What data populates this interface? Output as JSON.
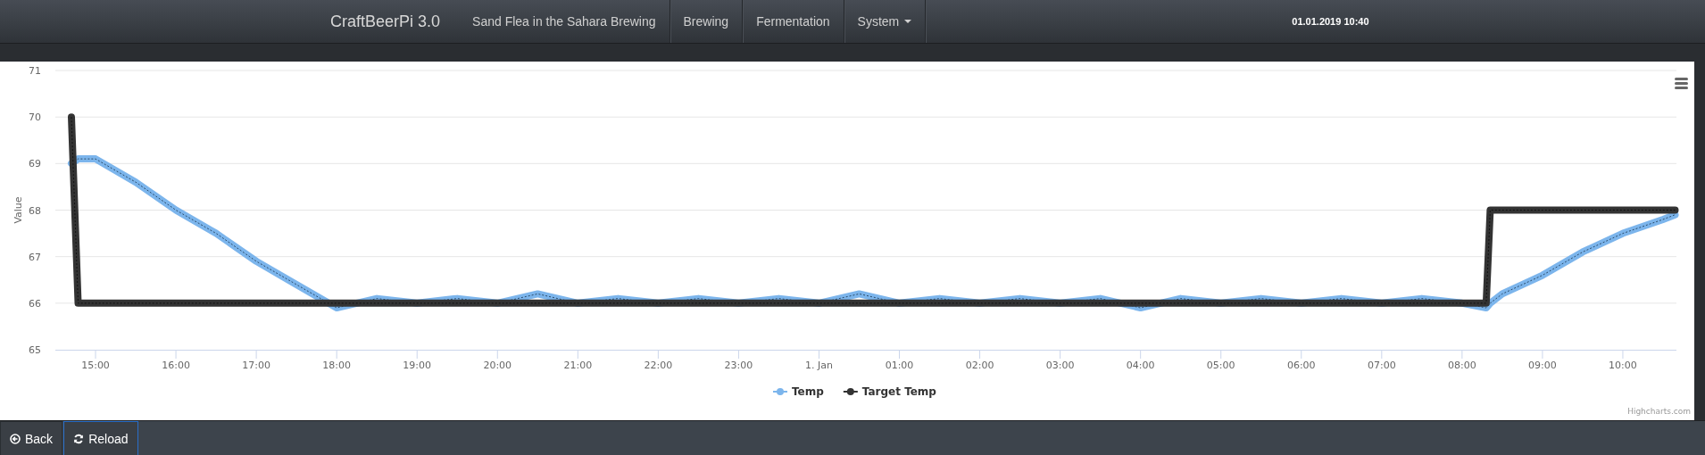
{
  "navbar": {
    "brand": "CraftBeerPi 3.0",
    "items": [
      {
        "label": "Sand Flea in the Sahara Brewing",
        "kind": "link"
      },
      {
        "label": "Brewing",
        "kind": "link"
      },
      {
        "label": "Fermentation",
        "kind": "link"
      },
      {
        "label": "System",
        "kind": "dropdown"
      }
    ],
    "datetime": "01.01.2019 10:40"
  },
  "chart": {
    "credit": "Highcharts.com",
    "chart_data": {
      "type": "line",
      "ylabel": "Value",
      "grid": true,
      "legend": true,
      "xlim": [
        "2018-12-31T14:30",
        "2019-01-01T10:40"
      ],
      "ylim": [
        65,
        71
      ],
      "yticks": [
        65,
        66,
        67,
        68,
        69,
        70,
        71
      ],
      "xticks": [
        {
          "value": "2018-12-31T15:00",
          "label": "15:00"
        },
        {
          "value": "2018-12-31T16:00",
          "label": "16:00"
        },
        {
          "value": "2018-12-31T17:00",
          "label": "17:00"
        },
        {
          "value": "2018-12-31T18:00",
          "label": "18:00"
        },
        {
          "value": "2018-12-31T19:00",
          "label": "19:00"
        },
        {
          "value": "2018-12-31T20:00",
          "label": "20:00"
        },
        {
          "value": "2018-12-31T21:00",
          "label": "21:00"
        },
        {
          "value": "2018-12-31T22:00",
          "label": "22:00"
        },
        {
          "value": "2018-12-31T23:00",
          "label": "23:00"
        },
        {
          "value": "2019-01-01T00:00",
          "label": "1. Jan"
        },
        {
          "value": "2019-01-01T01:00",
          "label": "01:00"
        },
        {
          "value": "2019-01-01T02:00",
          "label": "02:00"
        },
        {
          "value": "2019-01-01T03:00",
          "label": "03:00"
        },
        {
          "value": "2019-01-01T04:00",
          "label": "04:00"
        },
        {
          "value": "2019-01-01T05:00",
          "label": "05:00"
        },
        {
          "value": "2019-01-01T06:00",
          "label": "06:00"
        },
        {
          "value": "2019-01-01T07:00",
          "label": "07:00"
        },
        {
          "value": "2019-01-01T08:00",
          "label": "08:00"
        },
        {
          "value": "2019-01-01T09:00",
          "label": "09:00"
        },
        {
          "value": "2019-01-01T10:00",
          "label": "10:00"
        }
      ],
      "x": [
        "2018-12-31T14:42",
        "2018-12-31T14:47",
        "2018-12-31T15:00",
        "2018-12-31T15:30",
        "2018-12-31T16:00",
        "2018-12-31T16:30",
        "2018-12-31T17:00",
        "2018-12-31T17:30",
        "2018-12-31T18:00",
        "2018-12-31T18:30",
        "2018-12-31T19:00",
        "2018-12-31T19:30",
        "2018-12-31T20:00",
        "2018-12-31T20:30",
        "2018-12-31T21:00",
        "2018-12-31T21:30",
        "2018-12-31T22:00",
        "2018-12-31T22:30",
        "2018-12-31T23:00",
        "2018-12-31T23:30",
        "2019-01-01T00:00",
        "2019-01-01T00:30",
        "2019-01-01T01:00",
        "2019-01-01T01:30",
        "2019-01-01T02:00",
        "2019-01-01T02:30",
        "2019-01-01T03:00",
        "2019-01-01T03:30",
        "2019-01-01T04:00",
        "2019-01-01T04:30",
        "2019-01-01T05:00",
        "2019-01-01T05:30",
        "2019-01-01T06:00",
        "2019-01-01T06:30",
        "2019-01-01T07:00",
        "2019-01-01T07:30",
        "2019-01-01T08:00",
        "2019-01-01T08:18",
        "2019-01-01T08:21",
        "2019-01-01T08:30",
        "2019-01-01T09:00",
        "2019-01-01T09:30",
        "2019-01-01T10:00",
        "2019-01-01T10:30",
        "2019-01-01T10:39"
      ],
      "series": [
        {
          "name": "Temp",
          "color": "#7cb5ec",
          "values": [
            69,
            69.1,
            69.1,
            68.6,
            68.0,
            67.5,
            66.9,
            66.4,
            65.9,
            66.1,
            66.0,
            66.1,
            66.0,
            66.2,
            66.0,
            66.1,
            66.0,
            66.1,
            66.0,
            66.1,
            66.0,
            66.2,
            66.0,
            66.1,
            66.0,
            66.1,
            66.0,
            66.1,
            65.9,
            66.1,
            66.0,
            66.1,
            66.0,
            66.1,
            66.0,
            66.1,
            66.0,
            65.9,
            66.0,
            66.2,
            66.6,
            67.1,
            67.5,
            67.8,
            67.9
          ]
        },
        {
          "name": "Target Temp",
          "color": "#333333",
          "values": [
            70,
            66,
            66,
            66,
            66,
            66,
            66,
            66,
            66,
            66,
            66,
            66,
            66,
            66,
            66,
            66,
            66,
            66,
            66,
            66,
            66,
            66,
            66,
            66,
            66,
            66,
            66,
            66,
            66,
            66,
            66,
            66,
            66,
            66,
            66,
            66,
            66,
            66,
            68,
            68,
            68,
            68,
            68,
            68,
            68
          ]
        }
      ]
    }
  },
  "buttons": [
    {
      "label": "Back",
      "kind": "back",
      "focused": false
    },
    {
      "label": "Reload",
      "kind": "reload",
      "focused": true
    }
  ]
}
